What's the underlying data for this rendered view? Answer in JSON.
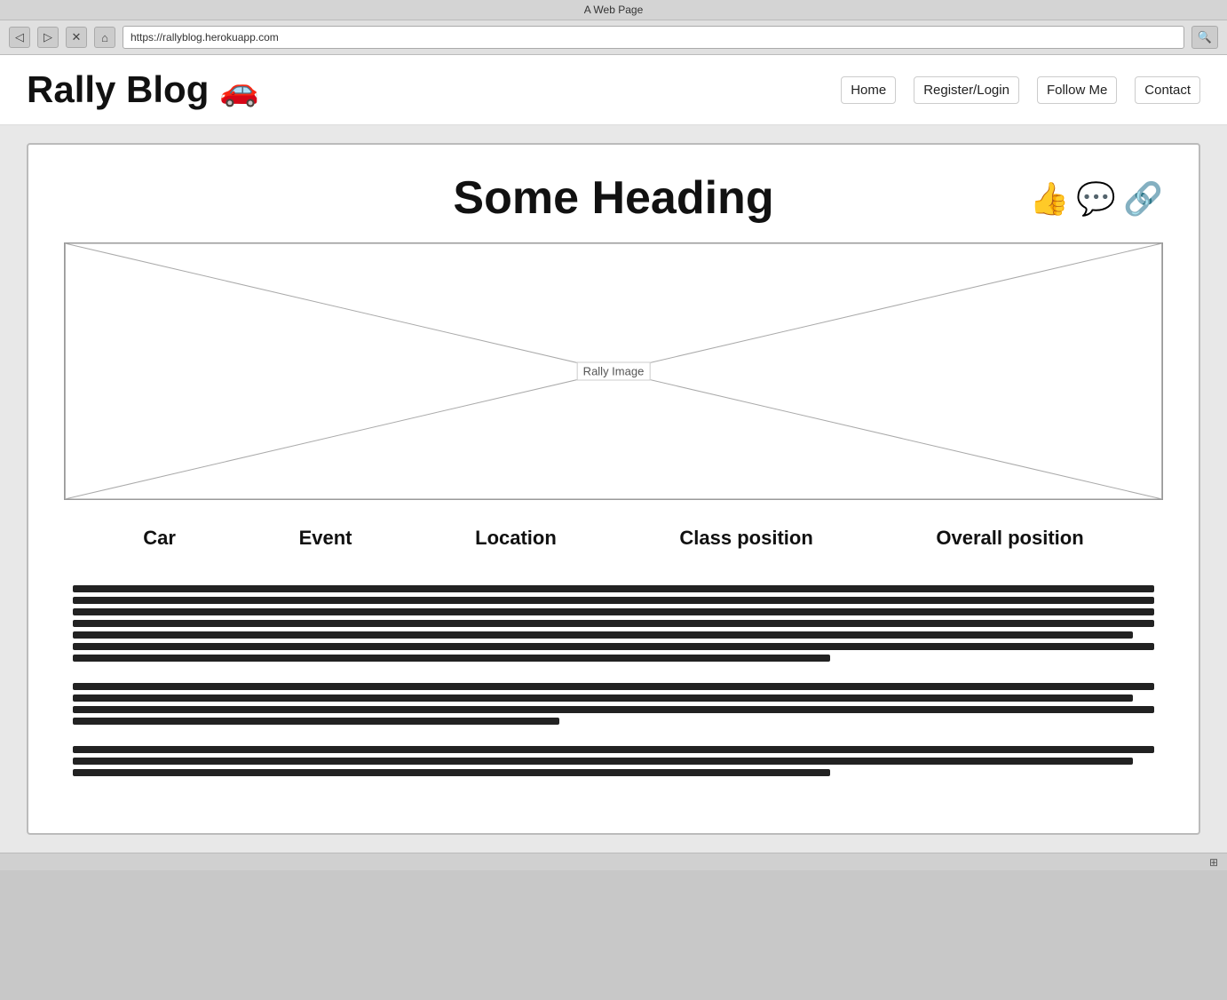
{
  "browser": {
    "title": "A Web Page",
    "url": "https://rallyblog.herokuapp.com",
    "nav": {
      "back": "◁",
      "forward": "▷",
      "stop": "✕",
      "home": "⌂"
    }
  },
  "site": {
    "logo_text": "Rally Blog",
    "car_icon": "🚗",
    "nav_items": [
      "Home",
      "Register/Login",
      "Follow Me",
      "Contact"
    ]
  },
  "post": {
    "heading": "Some Heading",
    "image_label": "Rally Image",
    "actions": {
      "like_icon": "👍",
      "comment_icon": "💬",
      "share_icon": "🔗"
    },
    "stats": [
      "Car",
      "Event",
      "Location",
      "Class position",
      "Overall position"
    ]
  }
}
